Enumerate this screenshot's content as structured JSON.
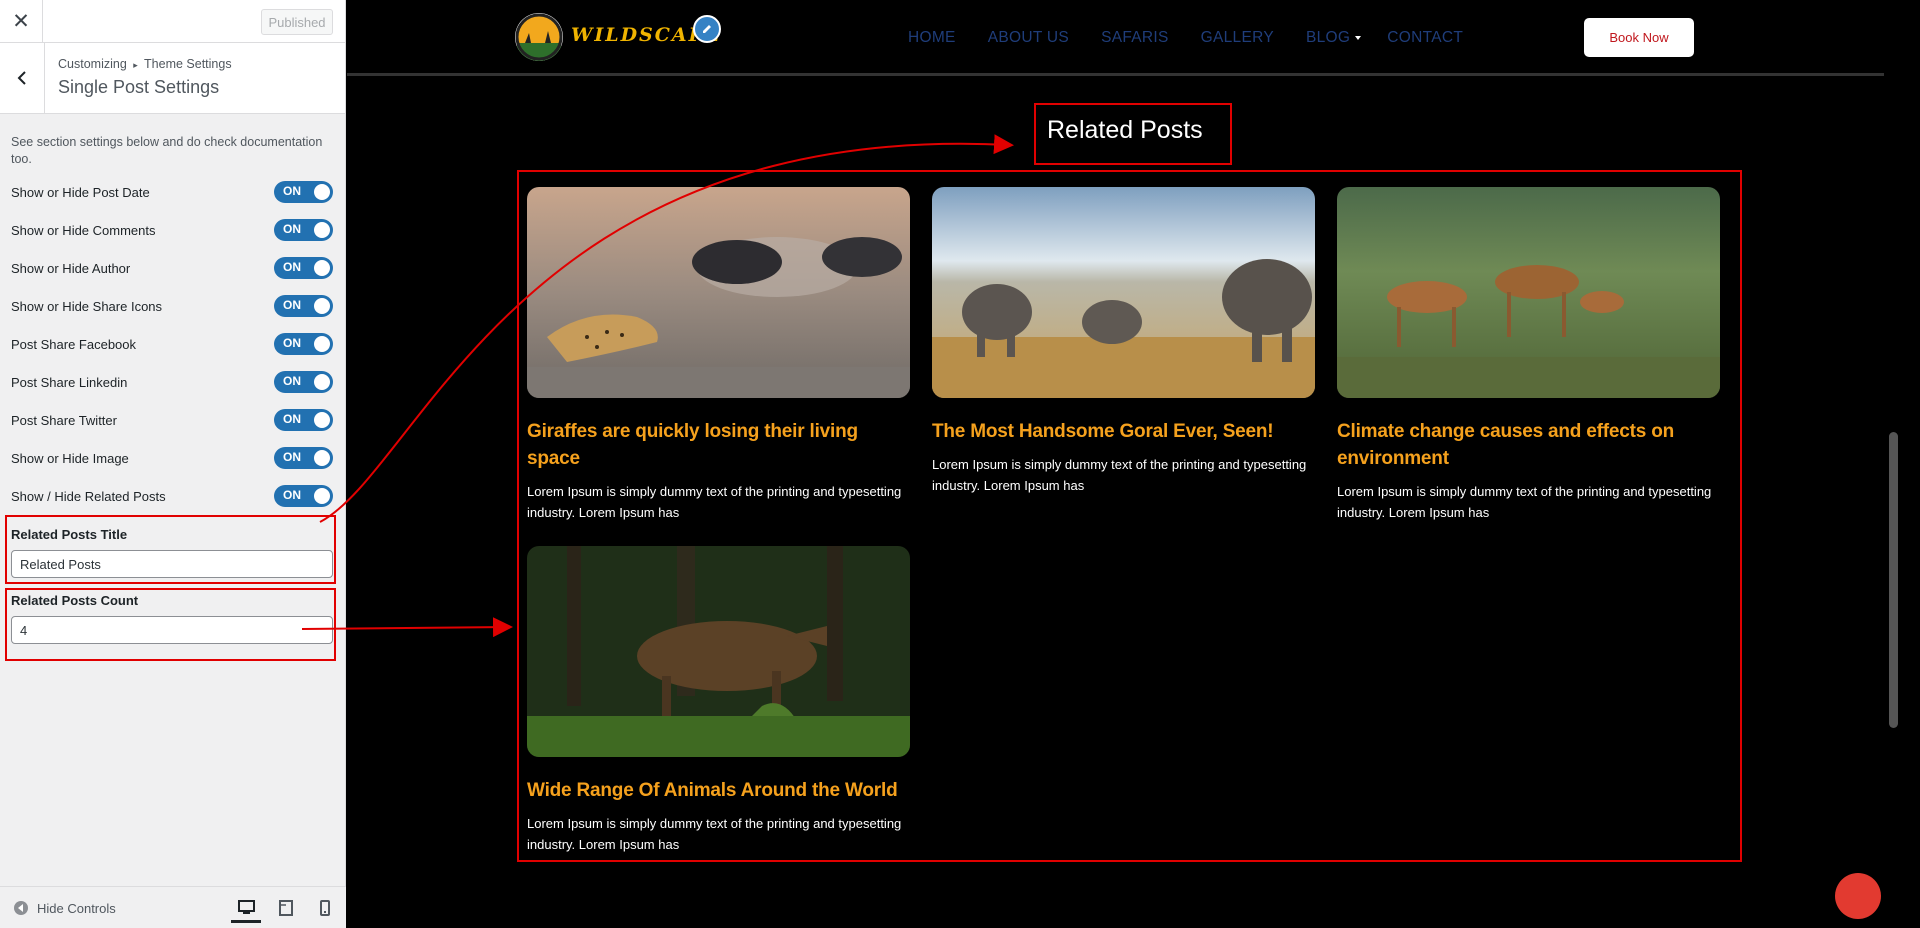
{
  "customizer": {
    "close_label": "✕",
    "publish_label": "Published",
    "breadcrumb_root": "Customizing",
    "breadcrumb_sep": "▸",
    "breadcrumb_parent": "Theme Settings",
    "section_title": "Single Post Settings",
    "description": "See section settings below and do check documentation too.",
    "toggles": [
      {
        "label": "Show or Hide Post Date",
        "state": "ON"
      },
      {
        "label": "Show or Hide Comments",
        "state": "ON"
      },
      {
        "label": "Show or Hide Author",
        "state": "ON"
      },
      {
        "label": "Show or Hide Share Icons",
        "state": "ON"
      },
      {
        "label": "Post Share Facebook",
        "state": "ON"
      },
      {
        "label": "Post Share Linkedin",
        "state": "ON"
      },
      {
        "label": "Post Share Twitter",
        "state": "ON"
      },
      {
        "label": "Show or Hide Image",
        "state": "ON"
      },
      {
        "label": "Show / Hide Related Posts",
        "state": "ON"
      }
    ],
    "related_title_label": "Related Posts Title",
    "related_title_value": "Related Posts",
    "related_count_label": "Related Posts Count",
    "related_count_value": "4",
    "hide_controls_label": "Hide Controls"
  },
  "site": {
    "logo_text": "WILDSCAPE",
    "nav": {
      "home": "HOME",
      "about": "ABOUT US",
      "safaris": "SAFARIS",
      "gallery": "GALLERY",
      "blog": "BLOG",
      "contact": "CONTACT"
    },
    "book_now": "Book Now",
    "related_heading": "Related Posts",
    "posts": [
      {
        "title": "Giraffes are quickly losing their living space",
        "excerpt": "Lorem Ipsum is simply dummy text of the printing and typesetting industry. Lorem Ipsum has"
      },
      {
        "title": "The Most Handsome Goral Ever, Seen!",
        "excerpt": "Lorem Ipsum is simply dummy text of the printing and typesetting industry. Lorem Ipsum has"
      },
      {
        "title": "Climate change causes and effects on environment",
        "excerpt": "Lorem Ipsum is simply dummy text of the printing and typesetting industry. Lorem Ipsum has"
      },
      {
        "title": "Wide Range Of Animals Around the World",
        "excerpt": "Lorem Ipsum is simply dummy text of the printing and typesetting industry. Lorem Ipsum has"
      }
    ]
  },
  "colors": {
    "toggle_on": "#2271b1",
    "annotation_red": "#e10000",
    "post_title": "#f5a11d",
    "nav_text": "#1f3d7a",
    "book_text": "#c0171d"
  }
}
